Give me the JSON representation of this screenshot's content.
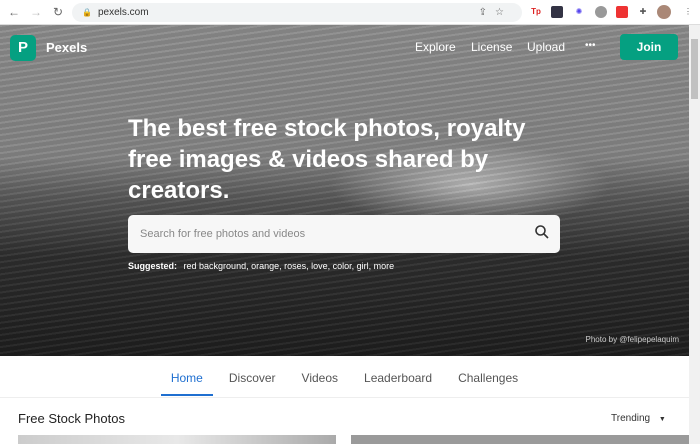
{
  "browser": {
    "url": "pexels.com"
  },
  "header": {
    "brand": "Pexels",
    "menu": [
      "Explore",
      "License",
      "Upload"
    ],
    "more": "•••",
    "join": "Join"
  },
  "hero": {
    "title": "The best free stock photos, royalty free images & videos shared by creators.",
    "search_placeholder": "Search for free photos and videos",
    "suggested_label": "Suggested:",
    "suggested": "red background, orange, roses, love, color, girl, more",
    "credit": "Photo by @felipepelaquim"
  },
  "tabs": [
    "Home",
    "Discover",
    "Videos",
    "Leaderboard",
    "Challenges"
  ],
  "section": {
    "title": "Free Stock Photos",
    "sort": "Trending"
  }
}
